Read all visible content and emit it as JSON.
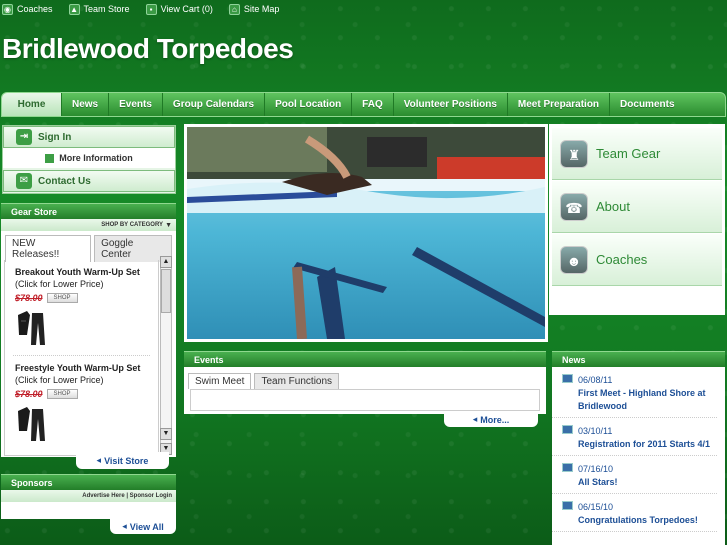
{
  "topbar": {
    "links": [
      {
        "label": "Coaches",
        "icon": "coaches-icon"
      },
      {
        "label": "Team Store",
        "icon": "shirt-icon"
      },
      {
        "label": "View Cart (0)",
        "icon": "cart-icon"
      },
      {
        "label": "Site Map",
        "icon": "home-icon"
      }
    ]
  },
  "site": {
    "title": "Bridlewood Torpedoes"
  },
  "nav": {
    "tabs": [
      "Home",
      "News",
      "Events",
      "Group Calendars",
      "Pool Location",
      "FAQ",
      "Volunteer Positions",
      "Meet Preparation",
      "Documents"
    ]
  },
  "account": {
    "sign_in": "Sign In",
    "more_info": "More Information",
    "contact_us": "Contact Us"
  },
  "gearstore": {
    "header": "Gear Store",
    "shop_by": "SHOP BY CATEGORY",
    "tabs": [
      "NEW Releases!!",
      "Goggle Center"
    ],
    "products": [
      {
        "name": "Breakout Youth Warm-Up Set",
        "note": "(Click for Lower Price)",
        "price": "$78.00",
        "shop": "SHOP"
      },
      {
        "name": "Freestyle Youth Warm-Up Set",
        "note": "(Click for Lower Price)",
        "price": "$78.00",
        "shop": "SHOP"
      }
    ],
    "visit": "Visit Store"
  },
  "sponsors": {
    "header": "Sponsors",
    "sub": "Advertise Here | Sponsor Login",
    "view_all": "View All"
  },
  "cards": [
    {
      "label": "Team Gear",
      "icon": "shirt-icon"
    },
    {
      "label": "About",
      "icon": "phone-icon"
    },
    {
      "label": "Coaches",
      "icon": "people-icon"
    }
  ],
  "events": {
    "header": "Events",
    "tabs": [
      "Swim Meet",
      "Team Functions"
    ],
    "more": "More..."
  },
  "news": {
    "header": "News",
    "items": [
      {
        "date": "06/08/11",
        "title": "First Meet - Highland Shore at Bridlewood"
      },
      {
        "date": "03/10/11",
        "title": "Registration for 2011 Starts 4/1"
      },
      {
        "date": "07/16/10",
        "title": "All Stars!"
      },
      {
        "date": "06/15/10",
        "title": "Congratulations Torpedoes!"
      }
    ]
  },
  "colors": {
    "accent": "#2e8a36",
    "link": "#1d4f96",
    "price": "#c0202a"
  }
}
